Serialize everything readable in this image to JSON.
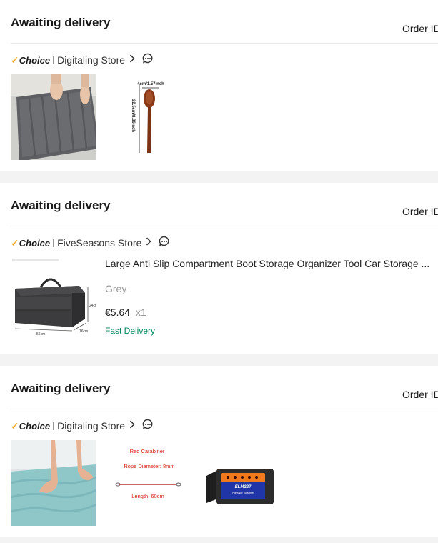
{
  "orders": [
    {
      "status": "Awaiting delivery",
      "order_id_label": "Order ID",
      "choice_label": "Choice",
      "store_name": "Digitaling Store",
      "items": [
        {
          "image": "gray-bath-mat"
        },
        {
          "image": "wooden-spoon",
          "caption_width": "4cm/1.57inch",
          "caption_height": "22.5cm/8.86inch"
        }
      ]
    },
    {
      "status": "Awaiting delivery",
      "order_id_label": "Order ID",
      "choice_label": "Choice",
      "store_name": "FiveSeasons Store",
      "items": [
        {
          "image": "car-storage-organizer",
          "dim_height": "24cm",
          "dim_length": "56cm",
          "dim_depth": "16cm",
          "title": "Large Anti Slip Compartment Boot Storage Organizer Tool Car Storage ...",
          "variant": "Grey",
          "price": "€5.64",
          "quantity": "x1",
          "shipping": "Fast Delivery"
        }
      ]
    },
    {
      "status": "Awaiting delivery",
      "order_id_label": "Order ID",
      "choice_label": "Choice",
      "store_name": "Digitaling Store",
      "items": [
        {
          "image": "aqua-bath-mat"
        },
        {
          "image": "red-carabiner-rope",
          "line1": "Red Carabiner",
          "line2": "Rope Diameter: 8mm",
          "line3": "Length: 60cm"
        },
        {
          "image": "obd2-scanner",
          "label": "ELM327",
          "sublabel": "Interface Scanner"
        }
      ]
    }
  ],
  "colors": {
    "choice_check": "#f5a000",
    "shipping_green": "#00875a",
    "background": "#f3f3f3"
  }
}
